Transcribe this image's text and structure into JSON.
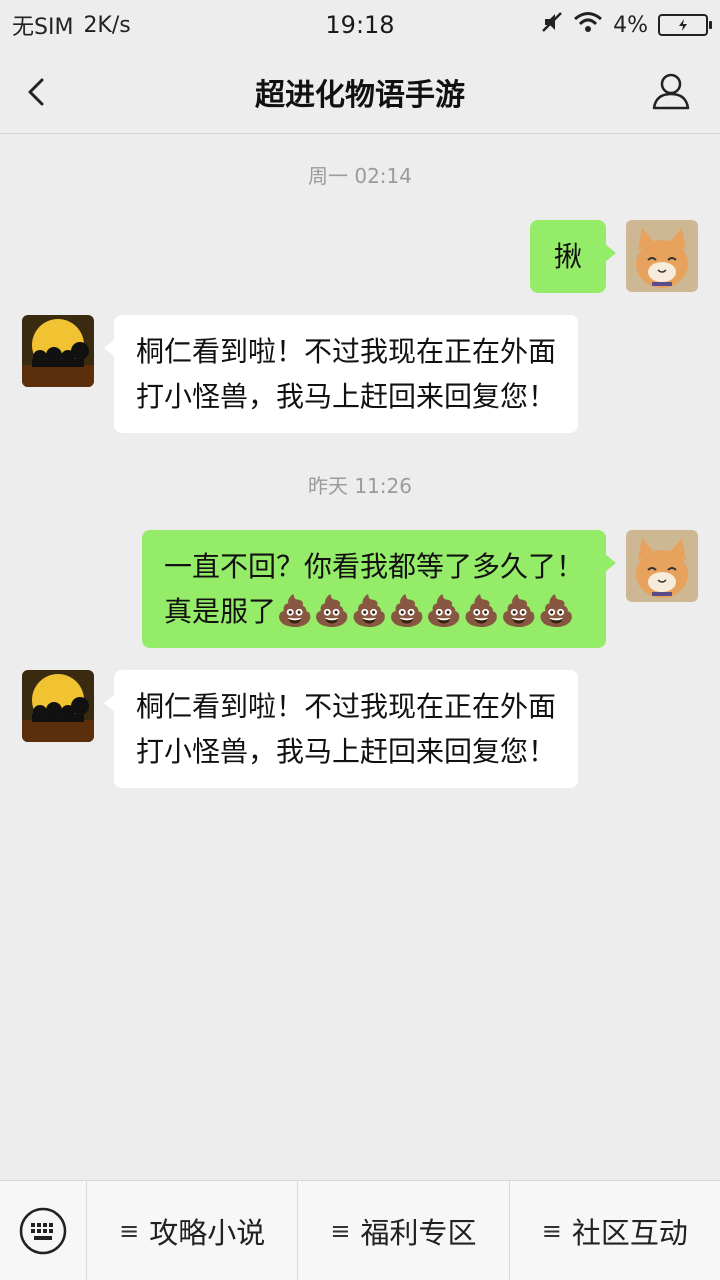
{
  "status_bar": {
    "carrier": "无SIM",
    "speed": "2K/s",
    "time": "19:18",
    "battery": "4%"
  },
  "header": {
    "title": "超进化物语手游"
  },
  "messages": [
    {
      "type": "time",
      "text": "周一 02:14"
    },
    {
      "type": "out",
      "text": "揪"
    },
    {
      "type": "in",
      "line1": "桐仁看到啦！不过我现在正在外面",
      "line2": "打小怪兽，我马上赶回来回复您！"
    },
    {
      "type": "time",
      "text": "昨天 11:26"
    },
    {
      "type": "out",
      "line1": "一直不回？你看我都等了多久了！",
      "line2": "真是服了",
      "emojis": "💩💩💩💩💩💩💩💩"
    },
    {
      "type": "in",
      "line1": "桐仁看到啦！不过我现在正在外面",
      "line2": "打小怪兽，我马上赶回来回复您！"
    }
  ],
  "bottom_menu": {
    "items": [
      {
        "label": "攻略小说",
        "icon": "≡"
      },
      {
        "label": "福利专区",
        "icon": "≡"
      },
      {
        "label": "社区互动",
        "icon": "≡"
      }
    ]
  },
  "colors": {
    "outgoing_bubble": "#95ec69",
    "incoming_bubble": "#ffffff",
    "background": "#ededed"
  }
}
